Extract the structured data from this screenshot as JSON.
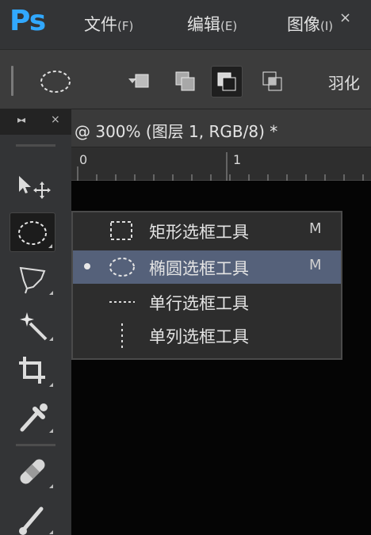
{
  "app": {
    "logo": "Ps"
  },
  "menu": [
    {
      "label": "文件",
      "hotkey": "(F)"
    },
    {
      "label": "编辑",
      "hotkey": "(E)"
    },
    {
      "label": "图像",
      "hotkey": "(I)"
    }
  ],
  "options_bar": {
    "tool_icon": "elliptical-marquee-icon",
    "selection_modes": [
      {
        "icon": "new-selection-icon",
        "active": false
      },
      {
        "icon": "add-to-selection-icon",
        "active": false
      },
      {
        "icon": "subtract-from-selection-icon",
        "active": true
      },
      {
        "icon": "intersect-selection-icon",
        "active": false
      }
    ],
    "feather_label": "羽化"
  },
  "toolbar": {
    "collapse_glyph": "▸◂",
    "close_glyph": "×",
    "tools": [
      {
        "icon": "move-tool-icon",
        "active": false
      },
      {
        "icon": "elliptical-marquee-icon",
        "active": true
      },
      {
        "icon": "lasso-tool-icon",
        "active": false
      },
      {
        "icon": "magic-wand-icon",
        "active": false
      },
      {
        "icon": "crop-tool-icon",
        "active": false
      },
      {
        "icon": "eyedropper-icon",
        "active": false
      },
      {
        "icon": "healing-brush-icon",
        "active": false
      },
      {
        "icon": "brush-tool-icon",
        "active": false
      }
    ]
  },
  "document": {
    "tab_title": "@ 300% (图层 1, RGB/8) *",
    "close_glyph": "×",
    "ruler_labels": [
      "0",
      "1"
    ]
  },
  "flyout": {
    "items": [
      {
        "label": "矩形选框工具",
        "shortcut": "M",
        "icon": "rectangular-marquee-icon",
        "selected": false
      },
      {
        "label": "椭圆选框工具",
        "shortcut": "M",
        "icon": "elliptical-marquee-icon",
        "selected": true
      },
      {
        "label": "单行选框工具",
        "shortcut": "",
        "icon": "single-row-marquee-icon",
        "selected": false
      },
      {
        "label": "单列选框工具",
        "shortcut": "",
        "icon": "single-column-marquee-icon",
        "selected": false
      }
    ]
  },
  "colors": {
    "brand": "#31a8ff",
    "panel": "#333436",
    "selected_row": "#55617a",
    "canvas": "#050505"
  }
}
